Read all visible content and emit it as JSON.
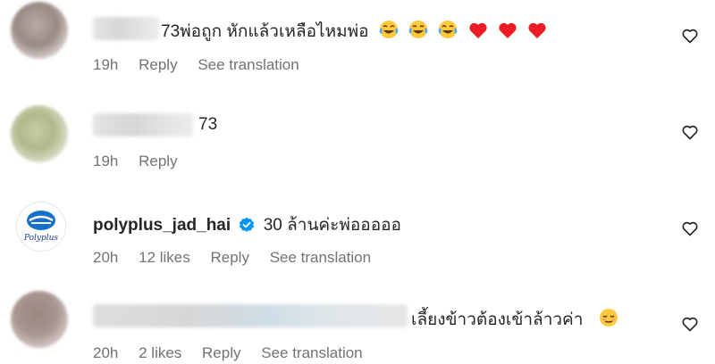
{
  "comments": [
    {
      "text": "73พ่อถูก หักแล้วเหลือไหมพ่อ",
      "time": "19h",
      "reply_label": "Reply",
      "translation_label": "See translation",
      "emojis": [
        "laughing-crying",
        "laughing-crying",
        "laughing-crying",
        "heart",
        "heart",
        "heart"
      ]
    },
    {
      "text": "73",
      "time": "19h",
      "reply_label": "Reply"
    },
    {
      "username": "polyplus_jad_hai",
      "text": "30 ล้านค่ะพ่อออออ",
      "time": "20h",
      "likes": "12 likes",
      "reply_label": "Reply",
      "translation_label": "See translation",
      "logo_text": "Polyplus"
    },
    {
      "text": "เลี้ยงข้าวต้องเข้าล้าวค่า",
      "time": "20h",
      "likes": "2 likes",
      "reply_label": "Reply",
      "translation_label": "See translation",
      "emojis": [
        "relieved-face"
      ]
    }
  ],
  "colors": {
    "text": "#262626",
    "meta": "#737373",
    "verified": "#0095f6",
    "heart": "#ed1c24"
  }
}
